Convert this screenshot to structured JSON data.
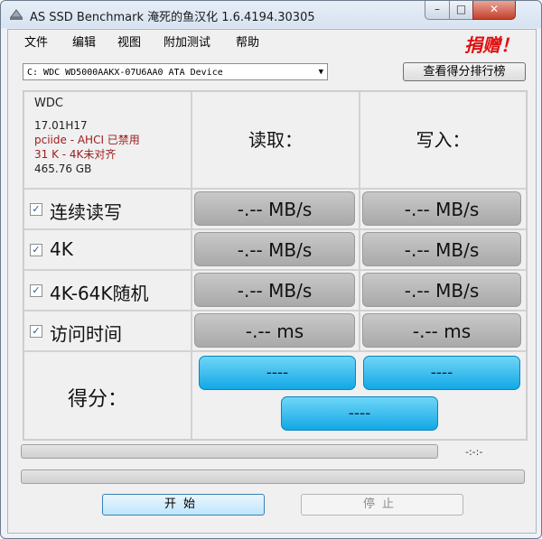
{
  "window": {
    "title": "AS SSD Benchmark 淹死的鱼汉化 1.6.4194.30305",
    "min_glyph": "–",
    "max_glyph": "□",
    "close_glyph": "✕"
  },
  "menu": {
    "items": [
      "文件",
      "编辑",
      "视图",
      "附加测试",
      "帮助"
    ],
    "donate": "捐赠！"
  },
  "drive": {
    "selected": "C: WDC WD5000AAKX-07U6AA0 ATA Device",
    "rank_button": "查看得分排行榜"
  },
  "info": {
    "vendor": "WDC",
    "firmware": "17.01H17",
    "driver": "pciide - AHCI 已禁用",
    "alignment": "31 K - 4K未对齐",
    "size": "465.76 GB"
  },
  "headers": {
    "read": "读取：",
    "write": "写入："
  },
  "tests": [
    {
      "label": "连续读写",
      "checked": true,
      "read": "-.-- MB/s",
      "write": "-.-- MB/s"
    },
    {
      "label": "4K",
      "checked": true,
      "read": "-.-- MB/s",
      "write": "-.-- MB/s"
    },
    {
      "label": "4K-64K随机",
      "checked": true,
      "read": "-.-- MB/s",
      "write": "-.-- MB/s"
    },
    {
      "label": "访问时间",
      "checked": true,
      "read": "-.-- ms",
      "write": "-.-- ms"
    }
  ],
  "score": {
    "label": "得分：",
    "read": "----",
    "write": "----",
    "total": "----"
  },
  "status": {
    "timer": "-:-:-"
  },
  "buttons": {
    "start": "开始",
    "stop": "停止"
  }
}
